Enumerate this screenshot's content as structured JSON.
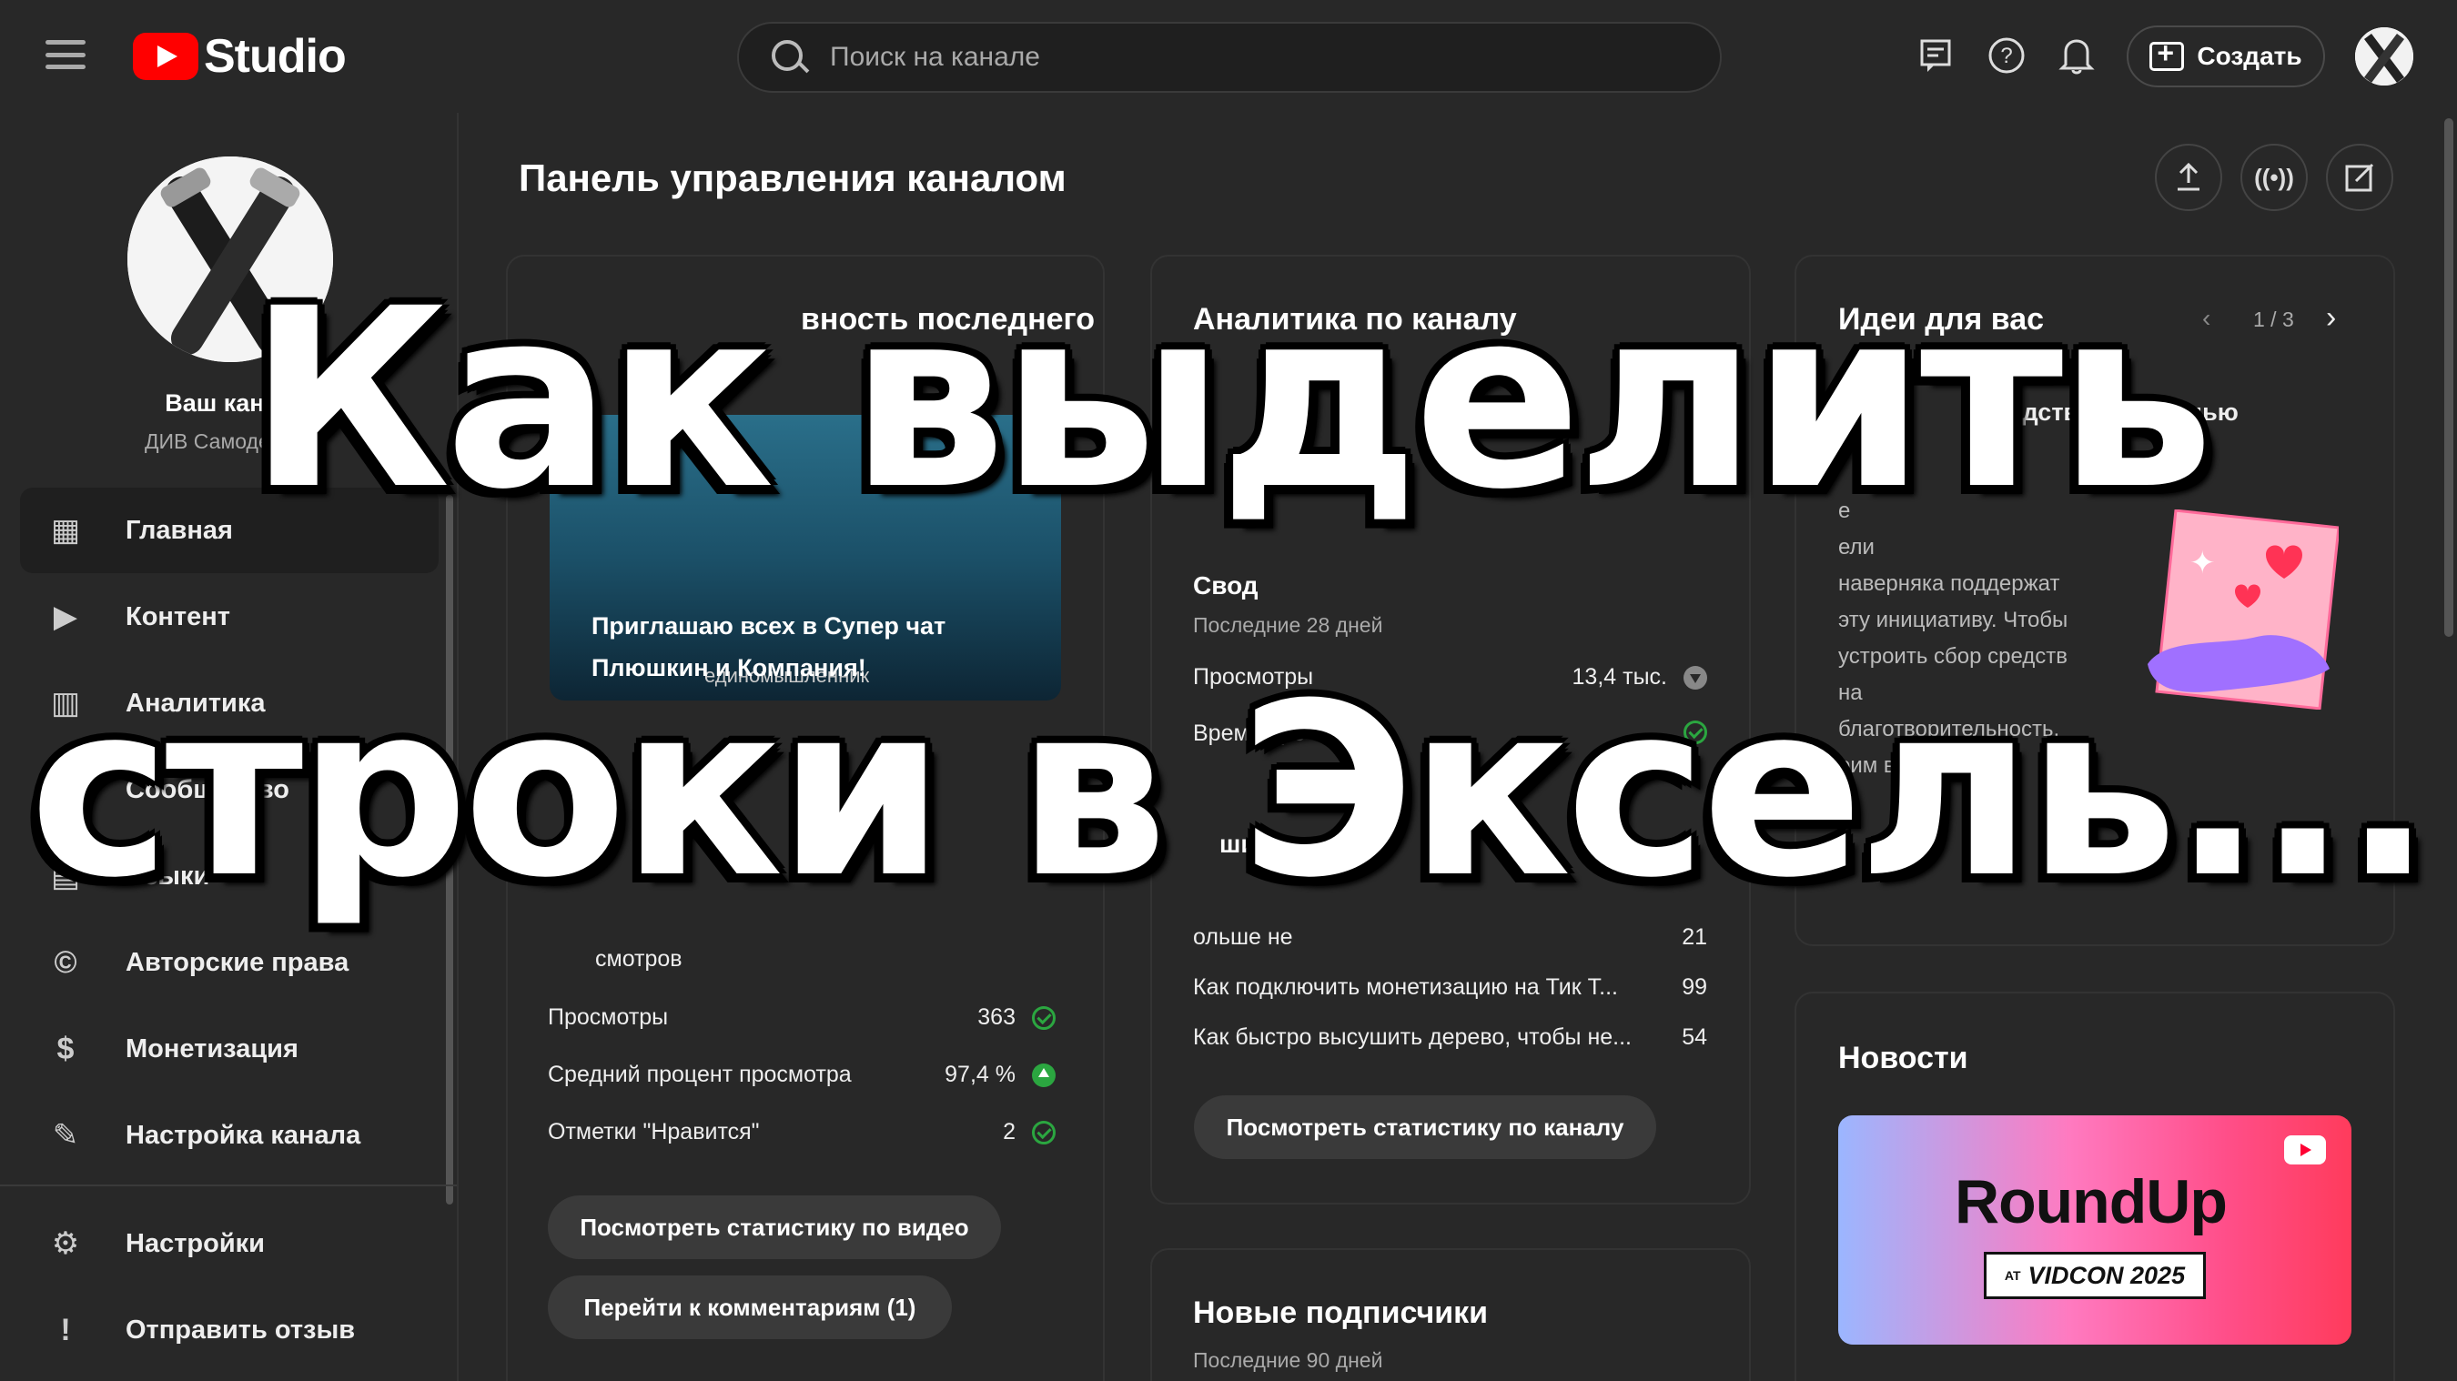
{
  "app": {
    "logo_text": "Studio"
  },
  "search": {
    "placeholder": "Поиск на канале"
  },
  "topbar": {
    "create_label": "Создать"
  },
  "sidebar": {
    "channel_title": "Ваш канал",
    "channel_name": "ДИВ Самоделкин",
    "items": [
      {
        "label": "Главная",
        "icon": "dashboard-icon",
        "glyph": "▦",
        "active": true
      },
      {
        "label": "Контент",
        "icon": "content-icon",
        "glyph": "▶"
      },
      {
        "label": "Аналитика",
        "icon": "analytics-icon",
        "glyph": "▥"
      },
      {
        "label": "Сообщество",
        "icon": "community-icon",
        "glyph": "☺"
      },
      {
        "label": "Языки",
        "icon": "subtitles-icon",
        "glyph": "▤"
      },
      {
        "label": "Авторские права",
        "icon": "copyright-icon",
        "glyph": "©"
      },
      {
        "label": "Монетизация",
        "icon": "money-icon",
        "glyph": "$"
      },
      {
        "label": "Настройка канала",
        "icon": "customization-icon",
        "glyph": "✎"
      }
    ],
    "bottom_items": [
      {
        "label": "Настройки",
        "icon": "settings-icon",
        "glyph": "⚙"
      },
      {
        "label": "Отправить отзыв",
        "icon": "feedback-icon",
        "glyph": "!"
      }
    ]
  },
  "main": {
    "page_title": "Панель управления каналом",
    "latest_video": {
      "title_visible_1": "вность последнего",
      "thumb_caption_1": "Приглашаю всех в Супер чат",
      "thumb_caption_2": "Плюшкин и Компания!",
      "thumb_sub": "единомышленник",
      "frag_1": "смотров",
      "metrics": [
        {
          "label": "Просмотры",
          "value": "363",
          "status": "check"
        },
        {
          "label": "Средний процент просмотра",
          "value": "97,4 %",
          "status": "up"
        },
        {
          "label": "Отметки \"Нравится\"",
          "value": "2",
          "status": "check"
        }
      ],
      "btn_stats": "Посмотреть статистику по видео",
      "btn_comments": "Перейти к комментариям (1)"
    },
    "analytics": {
      "title": "Аналитика по каналу",
      "summary_title": "Свод",
      "summary_period": "Последние 28 дней",
      "rows": [
        {
          "label": "Просмотры",
          "value": "13,4 тыс.",
          "status": "down"
        },
        {
          "label": "Время про",
          "value": "",
          "status": "check"
        }
      ],
      "top_videos_title": "шие видео",
      "top_videos": [
        {
          "title": "ольше не",
          "value": "21"
        },
        {
          "title": "Как подключить монетизацию на Тик Т...",
          "value": "99"
        },
        {
          "title": "Как быстро высушить дерево, чтобы не...",
          "value": "54"
        }
      ],
      "btn_channel_stats": "Посмотреть статистику по каналу"
    },
    "subscribers": {
      "title": "Новые подписчики",
      "period": "Последние 90 дней"
    },
    "ideas": {
      "title": "Идеи для вас",
      "pager": "1 / 3",
      "heading": "средства с помощью",
      "text_lines": [
        "е",
        "ели",
        "наверняка поддержат",
        "эту инициативу. Чтобы",
        "устроить сбор средств",
        "на",
        "благотворительность,",
        "оим видео кнопку"
      ]
    },
    "news": {
      "title": "Новости",
      "banner_logo": "RoundUp",
      "banner_badge_prefix": "AT",
      "banner_badge": "VIDCON 2025"
    }
  },
  "overlay": {
    "line1": "Как выделить",
    "line2": "строки в Эксель..."
  }
}
